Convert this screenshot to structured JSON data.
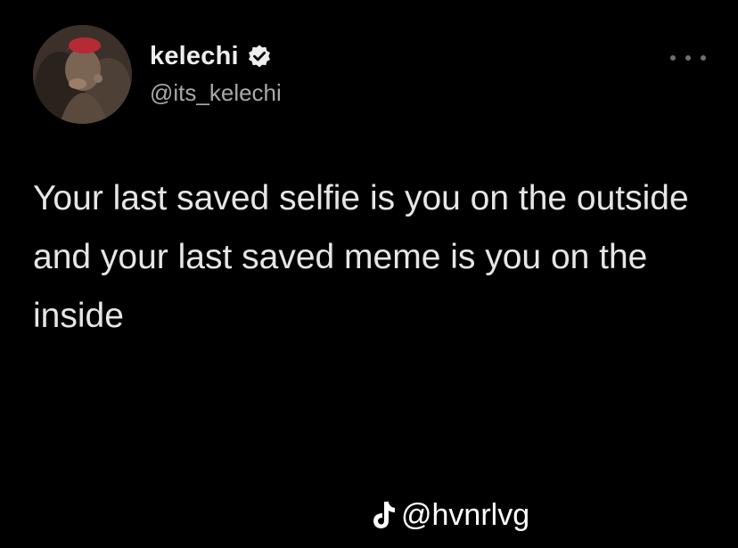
{
  "tweet": {
    "author": {
      "display_name": "kelechi",
      "handle": "@its_kelechi",
      "verified": true,
      "avatar_icon": "profile-photo"
    },
    "more_icon": "more-options-dots",
    "text": "Your last saved selfie is you on the outside and your last saved meme is you on the inside"
  },
  "watermark": {
    "icon": "tiktok-logo",
    "handle": "@hvnrlvg"
  },
  "colors": {
    "background": "#000000",
    "text": "#e6e6e6",
    "handle": "#a9a9a9",
    "dots": "#6f6f6f",
    "avatar_accent": "#c8323c"
  }
}
